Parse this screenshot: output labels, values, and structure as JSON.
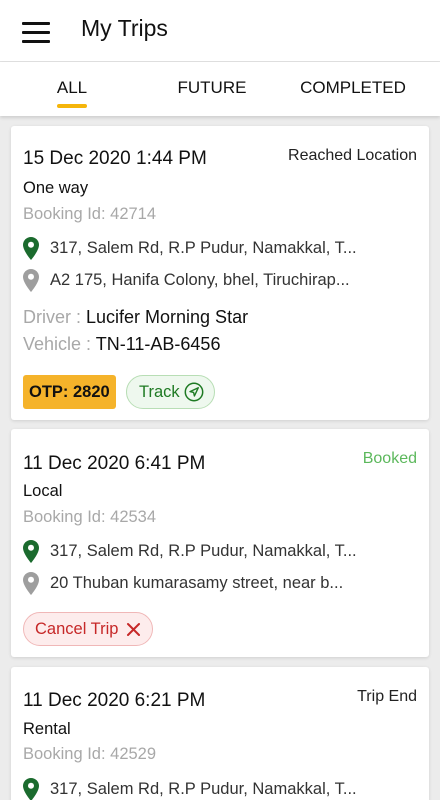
{
  "header": {
    "title": "My Trips",
    "menu_icon": "hamburger-menu-icon"
  },
  "tabs": [
    {
      "label": "ALL",
      "active": true
    },
    {
      "label": "FUTURE",
      "active": false
    },
    {
      "label": "COMPLETED",
      "active": false
    }
  ],
  "colors": {
    "accent": "#f5b50a",
    "pin_green": "#1b6b2e",
    "pin_grey": "#9e9e9e",
    "status_green": "#5cb85c",
    "cancel_red": "#c62828"
  },
  "trips": [
    {
      "datetime": "15 Dec 2020 1:44 PM",
      "status": "Reached Location",
      "type": "One way",
      "booking": "Booking Id: 42714",
      "pickup": "317, Salem Rd, R.P Pudur, Namakkal, T...",
      "drop": "A2 175, Hanifa Colony, bhel, Tiruchirap...",
      "driver_label": "Driver : ",
      "driver": "Lucifer Morning Star",
      "vehicle_label": "Vehicle : ",
      "vehicle": "TN-11-AB-6456",
      "otp": "OTP: 2820",
      "track_label": "Track"
    },
    {
      "datetime": "11 Dec 2020 6:41 PM",
      "status": "Booked",
      "type": "Local",
      "booking": "Booking Id: 42534",
      "pickup": "317, Salem Rd, R.P Pudur, Namakkal, T...",
      "drop": "20 Thuban kumarasamy street, near b...",
      "cancel_label": "Cancel Trip"
    },
    {
      "datetime": "11 Dec 2020 6:21 PM",
      "status": "Trip End",
      "type": "Rental",
      "booking": "Booking Id: 42529",
      "pickup": "317, Salem Rd, R.P Pudur, Namakkal, T..."
    }
  ]
}
